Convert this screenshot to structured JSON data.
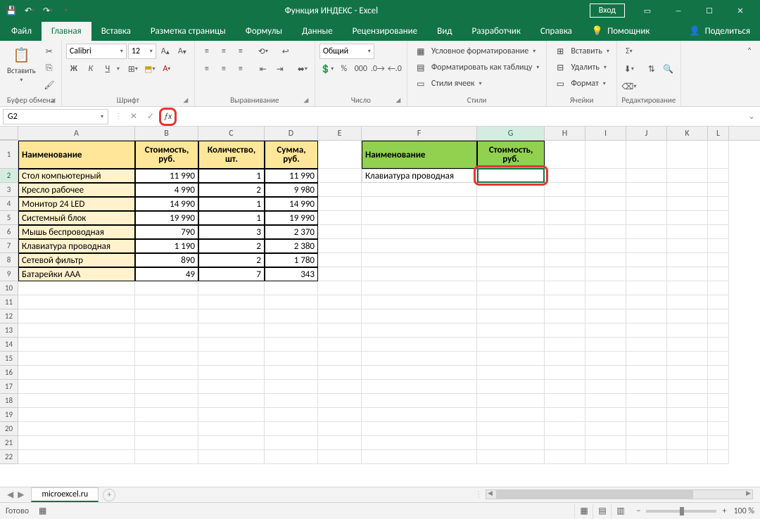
{
  "titlebar": {
    "title": "Функция ИНДЕКС  -  Excel",
    "login": "Вход"
  },
  "tabs": {
    "file": "Файл",
    "home": "Главная",
    "insert": "Вставка",
    "layout": "Разметка страницы",
    "formulas": "Формулы",
    "data": "Данные",
    "review": "Рецензирование",
    "view": "Вид",
    "developer": "Разработчик",
    "help": "Справка",
    "tellme": "Помощник",
    "share": "Поделиться"
  },
  "ribbon": {
    "clipboard": {
      "paste": "Вставить",
      "label": "Буфер обмена"
    },
    "font": {
      "name": "Calibri",
      "size": "12",
      "label": "Шрифт",
      "bold": "Ж",
      "italic": "К",
      "underline": "Ч"
    },
    "alignment": {
      "label": "Выравнивание"
    },
    "number": {
      "fmt": "Общий",
      "label": "Число"
    },
    "styles": {
      "cond": "Условное форматирование",
      "table": "Форматировать как таблицу",
      "cell": "Стили ячеек",
      "label": "Стили"
    },
    "cells": {
      "insert": "Вставить",
      "delete": "Удалить",
      "format": "Формат",
      "label": "Ячейки"
    },
    "editing": {
      "label": "Редактирование"
    }
  },
  "formula": {
    "namebox": "G2",
    "value": ""
  },
  "columns": [
    "A",
    "B",
    "C",
    "D",
    "E",
    "F",
    "G",
    "H",
    "I",
    "J",
    "K",
    "L"
  ],
  "headers1": {
    "name": "Наименование",
    "cost": "Стоимость, руб.",
    "qty": "Количество, шт.",
    "sum": "Сумма, руб."
  },
  "headers2": {
    "name": "Наименование",
    "cost": "Стоимость, руб."
  },
  "data1": [
    {
      "n": "Стол компьютерный",
      "c": "11 990",
      "q": "1",
      "s": "11 990"
    },
    {
      "n": "Кресло рабочее",
      "c": "4 990",
      "q": "2",
      "s": "9 980"
    },
    {
      "n": "Монитор 24 LED",
      "c": "14 990",
      "q": "1",
      "s": "14 990"
    },
    {
      "n": "Системный блок",
      "c": "19 990",
      "q": "1",
      "s": "19 990"
    },
    {
      "n": "Мышь беспроводная",
      "c": "790",
      "q": "3",
      "s": "2 370"
    },
    {
      "n": "Клавиатура проводная",
      "c": "1 190",
      "q": "2",
      "s": "2 380"
    },
    {
      "n": "Сетевой фильтр",
      "c": "890",
      "q": "2",
      "s": "1 780"
    },
    {
      "n": "Батарейки ААА",
      "c": "49",
      "q": "7",
      "s": "343"
    }
  ],
  "data2": {
    "f2": "Клавиатура проводная",
    "g2": ""
  },
  "sheet": {
    "name": "microexcel.ru"
  },
  "status": {
    "ready": "Готово",
    "zoom": "100 %"
  }
}
